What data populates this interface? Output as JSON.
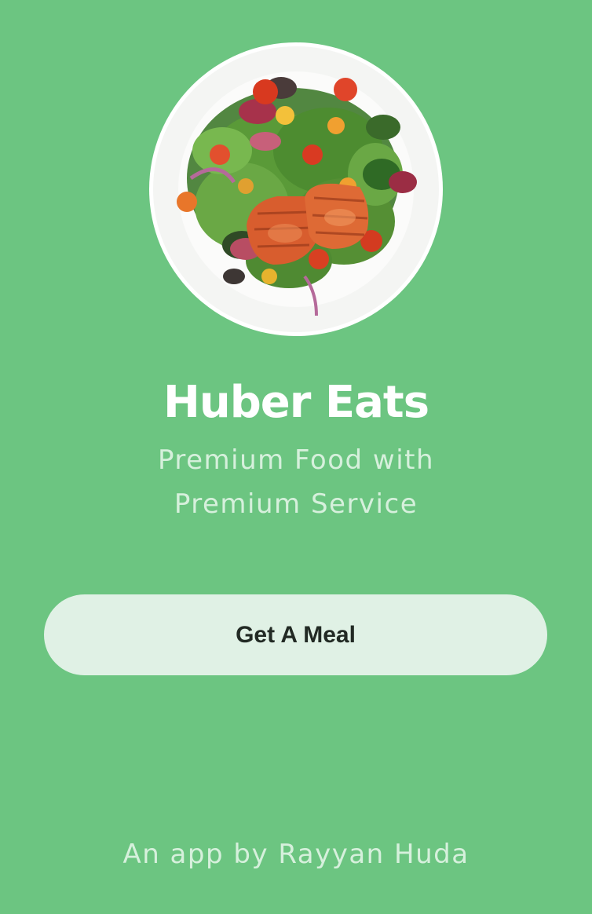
{
  "app": {
    "title": "Huber Eats",
    "subtitle_line1": "Premium Food with",
    "subtitle_line2": "Premium Service",
    "cta_label": "Get A Meal",
    "footer": "An app by Rayyan Huda"
  },
  "hero_image": {
    "icon": "salmon-salad-plate"
  },
  "colors": {
    "background": "#6cc581",
    "cta_background": "#e0f1e5",
    "cta_text": "#222a24",
    "title": "#ffffff",
    "subtle_text": "#d6f0dc"
  }
}
